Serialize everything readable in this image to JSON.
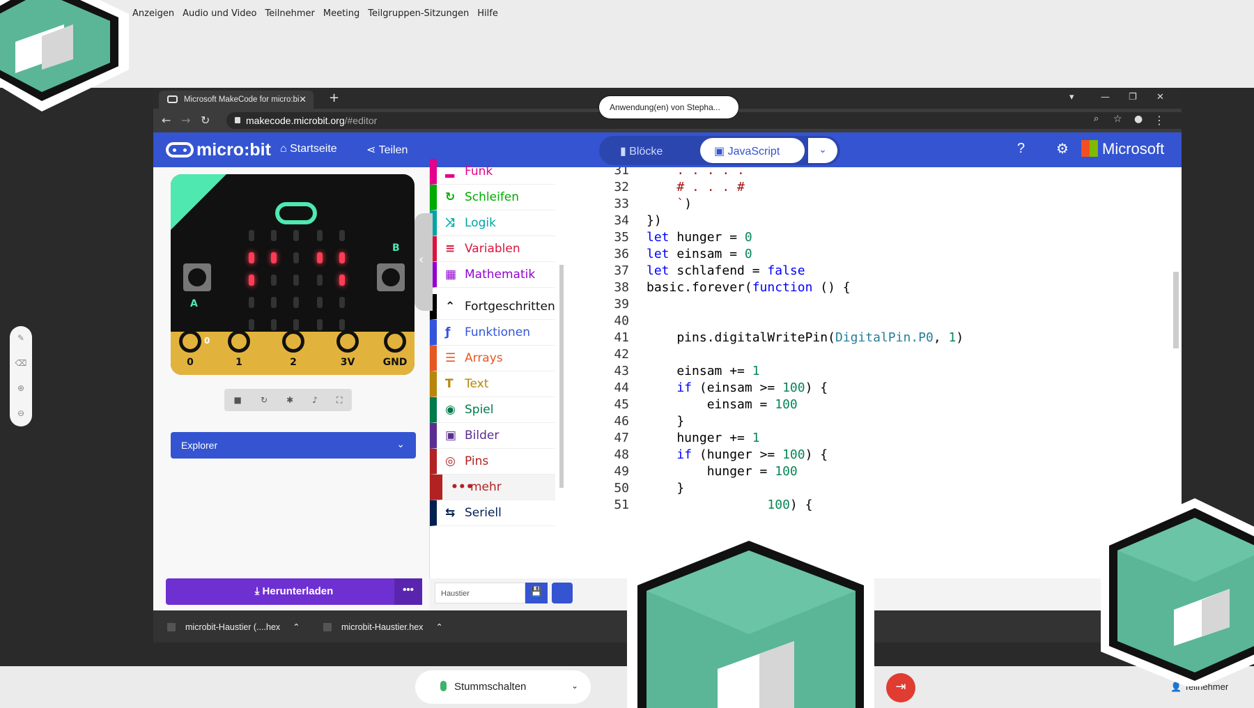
{
  "zoom_menu": [
    "Anzeigen",
    "Audio und Video",
    "Teilnehmer",
    "Meeting",
    "Teilgruppen-Sitzungen",
    "Hilfe"
  ],
  "share_badge": "Anwendung(en) von Stepha...",
  "browser": {
    "tab_title": "Microsoft MakeCode for micro:bi",
    "tab_close": "✕",
    "new_tab": "+",
    "url_host": "makecode.microbit.org",
    "url_path": "/#editor"
  },
  "header": {
    "logo": "micro:bit",
    "home": "Startseite",
    "share": "Teilen",
    "mode_blocks": "Blöcke",
    "mode_js": "JavaScript",
    "brand": "Microsoft"
  },
  "simulator": {
    "pins": [
      "0",
      "1",
      "2",
      "3V",
      "GND"
    ],
    "pin0_value": "0",
    "button_a": "A",
    "button_b": "B",
    "explorer": "Explorer",
    "download": "Herunterladen",
    "download_more": "•••",
    "leds_on": [
      [
        1,
        1
      ],
      [
        1,
        2
      ],
      [
        1,
        4
      ],
      [
        1,
        5
      ],
      [
        2,
        1
      ],
      [
        2,
        5
      ]
    ]
  },
  "toolbox": [
    {
      "label": "Funk",
      "color": "#e3008c",
      "icon": "signal-icon"
    },
    {
      "label": "Schleifen",
      "color": "#00aa00",
      "icon": "loop-icon"
    },
    {
      "label": "Logik",
      "color": "#00a4a6",
      "icon": "shuffle-icon"
    },
    {
      "label": "Variablen",
      "color": "#dc143c",
      "icon": "list-icon"
    },
    {
      "label": "Mathematik",
      "color": "#9400d3",
      "icon": "calculator-icon"
    },
    {
      "label": "Fortgeschritten",
      "color": "#000000",
      "icon": "chevron-up-icon"
    },
    {
      "label": "Funktionen",
      "color": "#3455db",
      "icon": "function-icon"
    },
    {
      "label": "Arrays",
      "color": "#e65722",
      "icon": "array-icon"
    },
    {
      "label": "Text",
      "color": "#b8860b",
      "icon": "text-icon"
    },
    {
      "label": "Spiel",
      "color": "#007a4b",
      "icon": "gamepad-icon"
    },
    {
      "label": "Bilder",
      "color": "#5c2d91",
      "icon": "image-icon"
    },
    {
      "label": "Pins",
      "color": "#b22222",
      "icon": "target-icon"
    },
    {
      "label": "mehr",
      "color": "#b22222",
      "icon": "more-icon"
    },
    {
      "label": "Seriell",
      "color": "#002050",
      "icon": "usb-icon"
    }
  ],
  "editor": {
    "line_numbers": [
      "31",
      "32",
      "33",
      "34",
      "35",
      "36",
      "37",
      "38",
      "39",
      "40",
      "41",
      "42",
      "43",
      "44",
      "45",
      "46",
      "47",
      "48",
      "49",
      "50",
      "51"
    ],
    "project_name": "Haustier"
  },
  "downloads": [
    "microbit-Haustier (....hex",
    "microbit-Haustier.hex"
  ],
  "zoom_bar": {
    "mute": "Stummschalten",
    "participants": "Teilnehmer"
  },
  "colors": {
    "makecode_blue": "#3454d1",
    "download_purple": "#6e30d1",
    "led_red": "#ff3c55",
    "hex_green": "#5ab697"
  }
}
